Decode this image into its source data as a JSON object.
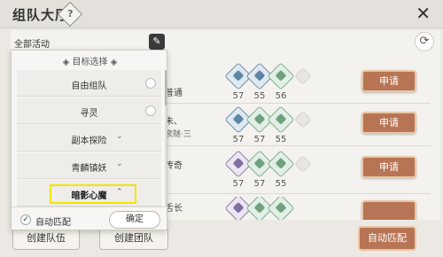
{
  "window": {
    "title": "组队大厅",
    "help": "?",
    "close": "✕"
  },
  "filter": {
    "label": "全部活动",
    "edit_icon": "✎"
  },
  "refresh_icon": "⟳",
  "rows": [
    {
      "name": "普通",
      "sub": "",
      "badges": [
        {
          "color": "blue",
          "level": "57"
        },
        {
          "color": "blue",
          "level": "55"
        },
        {
          "color": "green",
          "level": "56"
        }
      ],
      "apply": "申请"
    },
    {
      "name": "朱、",
      "sub": "衮隧·三",
      "badges": [
        {
          "color": "blue",
          "level": "57"
        },
        {
          "color": "green",
          "level": "57"
        },
        {
          "color": "green",
          "level": "55"
        }
      ],
      "apply": "申请"
    },
    {
      "name": "传奇",
      "sub": "",
      "badges": [
        {
          "color": "purple",
          "level": "57"
        },
        {
          "color": "green",
          "level": "57"
        },
        {
          "color": "green",
          "level": "55"
        }
      ],
      "apply": "申请"
    },
    {
      "name": "舌长",
      "sub": "",
      "badges": [
        {
          "color": "purple",
          "level": ""
        },
        {
          "color": "green",
          "level": ""
        },
        {
          "color": "green",
          "level": ""
        }
      ],
      "apply": ""
    }
  ],
  "dropdown": {
    "header": "◈ 目标选择 ◈",
    "items": [
      {
        "label": "自由组队",
        "type": "radio"
      },
      {
        "label": "寻灵",
        "type": "radio"
      },
      {
        "label": "副本探险",
        "type": "expand",
        "chevron": "⌄"
      },
      {
        "label": "青麟镇妖",
        "type": "expand",
        "chevron": "⌄"
      },
      {
        "label": "暗影心魔",
        "type": "expand",
        "chevron": "⌃"
      }
    ],
    "auto_match_check": "✓",
    "auto_match_label": "自动匹配",
    "confirm": "确定"
  },
  "bottom": {
    "create_team": "创建队伍",
    "create_group": "创建团队",
    "auto_match": "自动匹配"
  }
}
